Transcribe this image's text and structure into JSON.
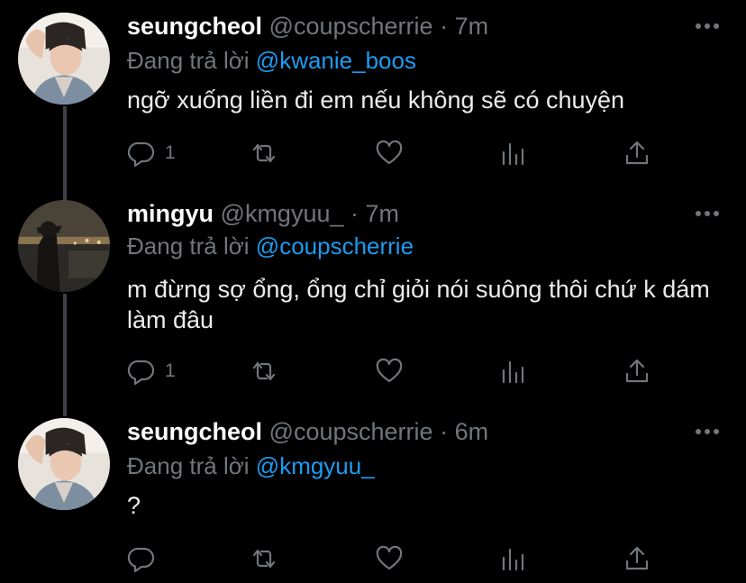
{
  "colors": {
    "background": "#000000",
    "name": "#ffffff",
    "muted": "#71767b",
    "link": "#1d9bf0",
    "thread_line": "#3d4147"
  },
  "reply_prefix": "Đang trả lời",
  "tweets": [
    {
      "name": "seungcheol",
      "handle": "@coupscherrie",
      "separator": "·",
      "time": "7m",
      "reply_to": "@kwanie_boos",
      "text": "ngỡ xuống liền đi em nếu không sẽ có chuyện",
      "reply_count": "1",
      "avatar": "seungcheol-avatar"
    },
    {
      "name": "mingyu",
      "handle": "@kmgyuu_",
      "separator": "·",
      "time": "7m",
      "reply_to": "@coupscherrie",
      "text": "m đừng sợ ổng, ổng chỉ giỏi nói suông thôi chứ k dám làm đâu",
      "reply_count": "1",
      "avatar": "mingyu-avatar"
    },
    {
      "name": "seungcheol",
      "handle": "@coupscherrie",
      "separator": "·",
      "time": "6m",
      "reply_to": "@kmgyuu_",
      "text": "?",
      "reply_count": "",
      "avatar": "seungcheol-avatar"
    }
  ],
  "icons": [
    "reply-icon",
    "retweet-icon",
    "like-icon",
    "analytics-icon",
    "share-icon",
    "more-icon"
  ]
}
